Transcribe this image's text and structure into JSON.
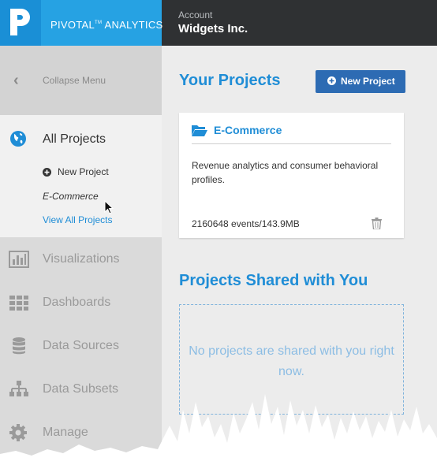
{
  "header": {
    "brand": "PIVOTAL",
    "brand_tm": "TM",
    "brand_suffix": " ANALYTICS",
    "account_label": "Account",
    "account_name": "Widgets Inc."
  },
  "sidebar": {
    "collapse_label": "Collapse Menu",
    "active": {
      "label": "All Projects",
      "new_project": "New Project",
      "current_project": "E-Commerce",
      "view_all": "View All Projects"
    },
    "items": [
      {
        "label": "Visualizations",
        "icon": "bar-chart-icon"
      },
      {
        "label": "Dashboards",
        "icon": "grid-icon"
      },
      {
        "label": "Data Sources",
        "icon": "database-icon"
      },
      {
        "label": "Data Subsets",
        "icon": "sitemap-icon"
      },
      {
        "label": "Manage",
        "icon": "gear-icon"
      }
    ]
  },
  "main": {
    "title": "Your Projects",
    "new_project_button": "New Project",
    "project": {
      "name": "E-Commerce",
      "description": "Revenue analytics and consumer behavioral profiles.",
      "stats": "2160648 events/143.9MB"
    },
    "shared_title": "Projects Shared with You",
    "shared_empty": "No projects are shared with you right now."
  },
  "colors": {
    "accent": "#1f8dd6",
    "button": "#2d6bb3",
    "topbar": "#2f3133"
  }
}
